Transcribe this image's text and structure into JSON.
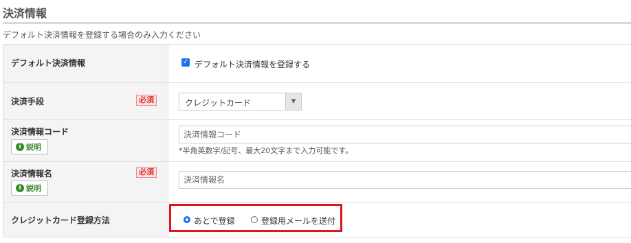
{
  "section": {
    "title": "決済情報",
    "note": "デフォルト決済情報を登録する場合のみ入力ください"
  },
  "rows": {
    "default": {
      "label": "デフォルト決済情報",
      "checkbox_label": "デフォルト決済情報を登録する",
      "checked": true
    },
    "method": {
      "label": "決済手段",
      "required": "必須",
      "select_value": "クレジットカード"
    },
    "code": {
      "label": "決済情報コード",
      "help": "説明",
      "placeholder": "決済情報コード",
      "hint": "*半角英数字/記号、最大20文字まで入力可能です。"
    },
    "name": {
      "label": "決済情報名",
      "required": "必須",
      "help": "説明",
      "placeholder": "決済情報名"
    },
    "card_registration": {
      "label": "クレジットカード登録方法",
      "options": [
        "あとで登録",
        "登録用メールを送付"
      ],
      "selected": "あとで登録"
    }
  },
  "colors": {
    "highlight_border": "#e0141b",
    "required_text": "#dd3333",
    "help_text": "#3a8a2a"
  }
}
